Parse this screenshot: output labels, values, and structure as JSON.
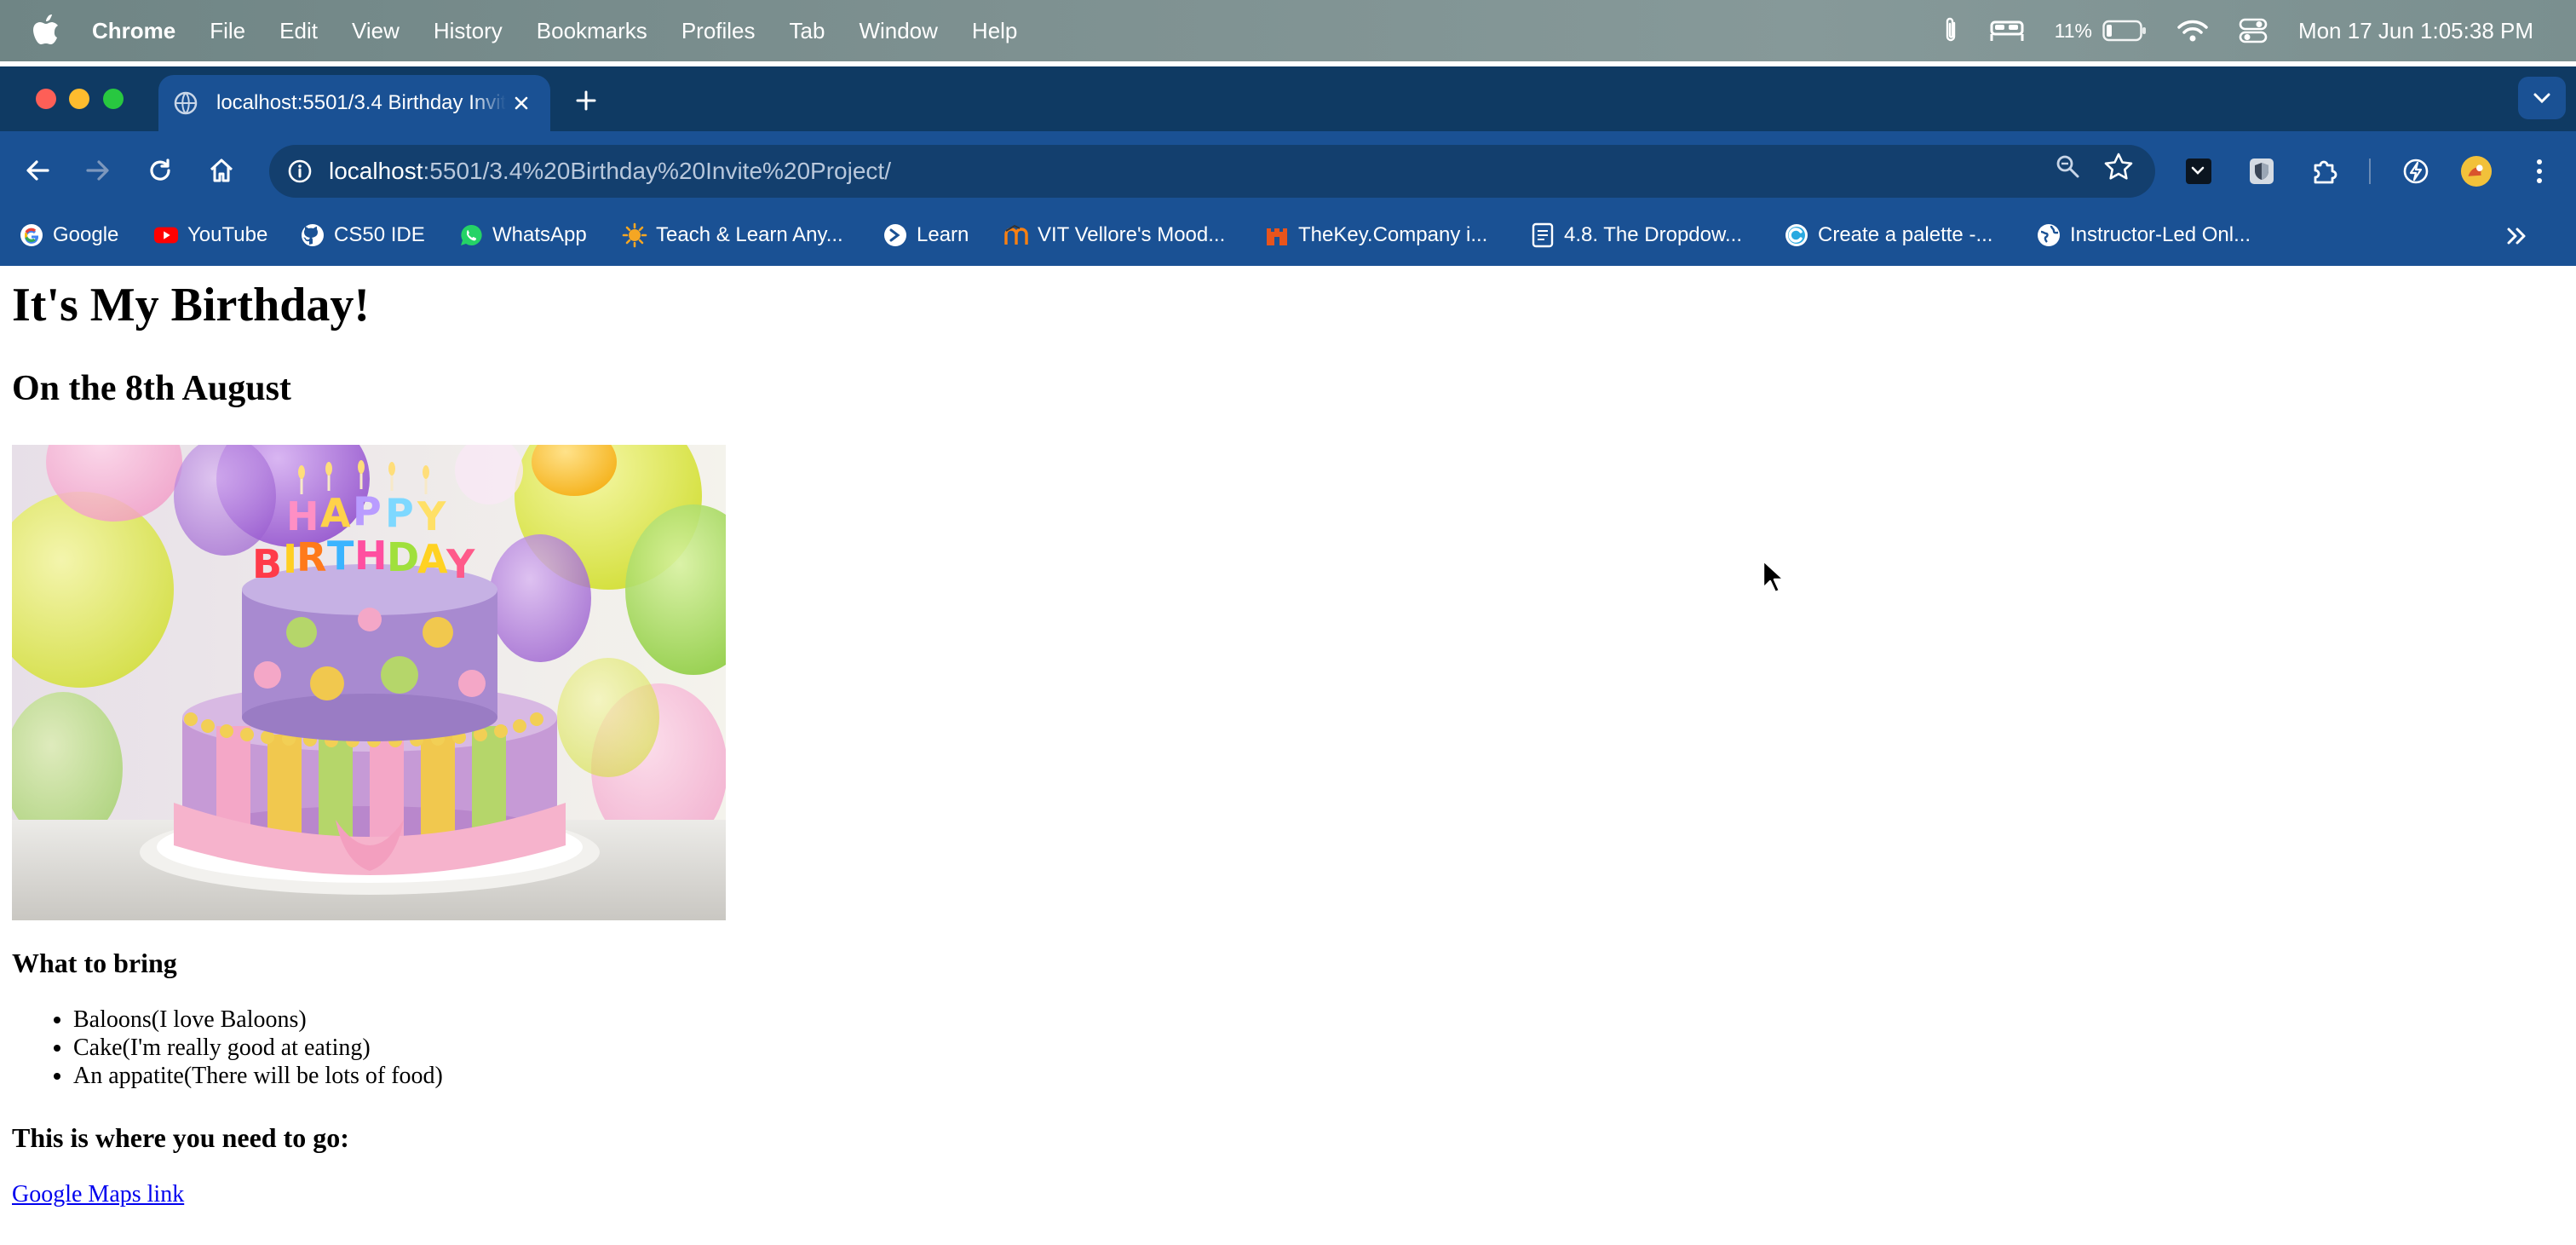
{
  "menubar": {
    "app_name": "Chrome",
    "items": [
      "File",
      "Edit",
      "View",
      "History",
      "Bookmarks",
      "Profiles",
      "Tab",
      "Window",
      "Help"
    ],
    "battery_percent": "11%",
    "clock": "Mon 17 Jun  1:05:38 PM"
  },
  "browser": {
    "tab": {
      "title": "localhost:5501/3.4 Birthday Invite"
    },
    "address": {
      "host": "localhost",
      "path": ":5501/3.4%20Birthday%20Invite%20Project/"
    },
    "bookmarks": [
      {
        "label": "Google",
        "icon": "google-icon"
      },
      {
        "label": "YouTube",
        "icon": "youtube-icon"
      },
      {
        "label": "CS50 IDE",
        "icon": "github-icon"
      },
      {
        "label": "WhatsApp",
        "icon": "whatsapp-icon"
      },
      {
        "label": "Teach & Learn Any...",
        "icon": "sun-icon"
      },
      {
        "label": "Learn",
        "icon": "learn-icon"
      },
      {
        "label": "VIT Vellore's Mood...",
        "icon": "moodle-icon"
      },
      {
        "label": "TheKey.Company i...",
        "icon": "castle-icon"
      },
      {
        "label": "4.8. The Dropdow...",
        "icon": "doc-icon"
      },
      {
        "label": "Create a palette -...",
        "icon": "palette-icon"
      },
      {
        "label": "Instructor-Led Onl...",
        "icon": "globe-icon"
      }
    ]
  },
  "page": {
    "title": "It's My Birthday!",
    "date": "On the 8th August",
    "image": {
      "cake_text": "HAPPY BIRTHDAY"
    },
    "bring_heading": "What to bring",
    "bring_items": [
      "Baloons(I love Baloons)",
      "Cake(I'm really good at eating)",
      "An appatite(There will be lots of food)"
    ],
    "where_heading": "This is where you need to go:",
    "maps_link": "Google Maps link"
  }
}
